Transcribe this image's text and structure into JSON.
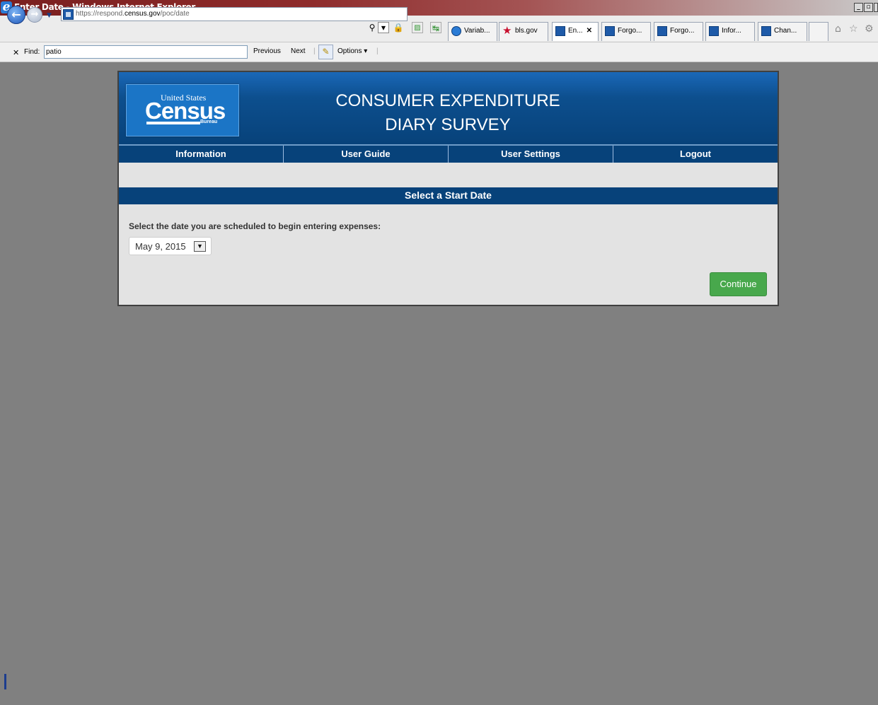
{
  "window": {
    "title": "Enter Date - Windows Internet Explorer"
  },
  "browser": {
    "url_prefix": "https://respond.",
    "url_domain": "census.gov",
    "url_path": "/poc/date",
    "tabs": [
      {
        "label": "Variab...",
        "icon": "ie-icon"
      },
      {
        "label": "bls.gov",
        "icon": "star-icon"
      },
      {
        "label": "En...",
        "icon": "census-favicon-icon",
        "active": true
      },
      {
        "label": "Forgo...",
        "icon": "census-favicon-icon"
      },
      {
        "label": "Forgo...",
        "icon": "census-favicon-icon"
      },
      {
        "label": "Infor...",
        "icon": "census-favicon-icon"
      },
      {
        "label": "Chan...",
        "icon": "census-favicon-icon"
      }
    ]
  },
  "findbar": {
    "label": "Find:",
    "query": "patio",
    "previous": "Previous",
    "next": "Next",
    "options": "Options"
  },
  "page": {
    "logo": {
      "united_states": "United States",
      "census": "Census",
      "bureau": "Bureau"
    },
    "title_line1": "CONSUMER EXPENDITURE",
    "title_line2": "DIARY SURVEY",
    "nav": [
      "Information",
      "User Guide",
      "User Settings",
      "Logout"
    ],
    "section_title": "Select a Start Date",
    "prompt": "Select the date you are scheduled to begin entering expenses:",
    "selected_date": "May 9, 2015",
    "continue_label": "Continue"
  },
  "colors": {
    "header_blue": "#07427a",
    "continue_green": "#48a84c",
    "background_gray": "#808080"
  }
}
